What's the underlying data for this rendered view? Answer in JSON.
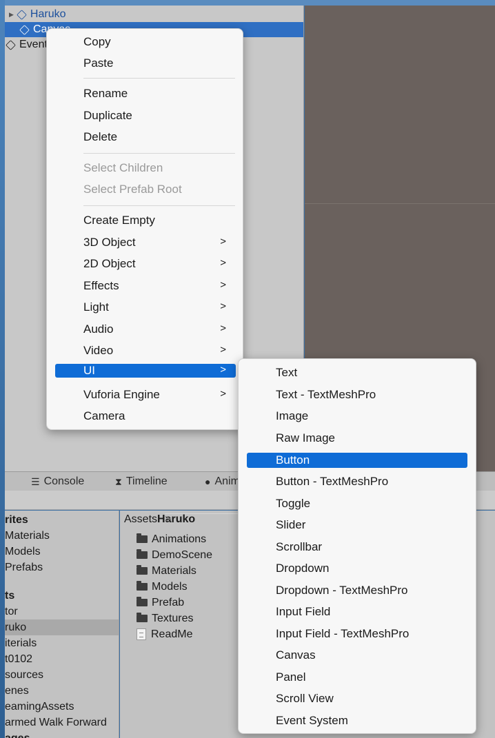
{
  "hierarchy": {
    "items": [
      "Haruko",
      "Canvas",
      "EventSystem"
    ]
  },
  "bottom_tabs": {
    "console": "Console",
    "timeline": "Timeline",
    "animation": "Animation"
  },
  "project": {
    "left_items": [
      {
        "label": "rites",
        "bold": true
      },
      {
        "label": "Materials"
      },
      {
        "label": "Models"
      },
      {
        "label": "Prefabs"
      },
      {
        "label": "ts",
        "bold": true
      },
      {
        "label": "tor"
      },
      {
        "label": "ruko"
      },
      {
        "label": "iterials"
      },
      {
        "label": "t0102"
      },
      {
        "label": "sources"
      },
      {
        "label": "enes"
      },
      {
        "label": "eamingAssets"
      },
      {
        "label": "armed Walk Forward"
      },
      {
        "label": "ages"
      }
    ],
    "breadcrumb": {
      "root": "Assets",
      "separator": ">",
      "current": "Haruko"
    },
    "assets": [
      {
        "label": "Animations",
        "icon": "folder-icon"
      },
      {
        "label": "DemoScene",
        "icon": "folder-icon"
      },
      {
        "label": "Materials",
        "icon": "folder-icon"
      },
      {
        "label": "Models",
        "icon": "folder-icon"
      },
      {
        "label": "Prefab",
        "icon": "folder-icon"
      },
      {
        "label": "Textures",
        "icon": "folder-icon"
      },
      {
        "label": "ReadMe",
        "icon": "document-icon"
      }
    ]
  },
  "context_menu": {
    "items": [
      {
        "label": "Copy"
      },
      {
        "label": "Paste"
      },
      {
        "label": "Rename"
      },
      {
        "label": "Duplicate"
      },
      {
        "label": "Delete"
      },
      {
        "label": "Select Children",
        "disabled": true
      },
      {
        "label": "Select Prefab Root",
        "disabled": true
      },
      {
        "label": "Create Empty"
      },
      {
        "label": "3D Object",
        "submenu": true
      },
      {
        "label": "2D Object",
        "submenu": true
      },
      {
        "label": "Effects",
        "submenu": true
      },
      {
        "label": "Light",
        "submenu": true
      },
      {
        "label": "Audio",
        "submenu": true
      },
      {
        "label": "Video",
        "submenu": true
      },
      {
        "label": "UI",
        "submenu": true,
        "selected": true
      },
      {
        "label": "Vuforia Engine",
        "submenu": true
      },
      {
        "label": "Camera"
      }
    ],
    "arrow": ">"
  },
  "ui_submenu": {
    "items": [
      {
        "label": "Text"
      },
      {
        "label": "Text - TextMeshPro"
      },
      {
        "label": "Image"
      },
      {
        "label": "Raw Image"
      },
      {
        "label": "Button",
        "selected": true
      },
      {
        "label": "Button - TextMeshPro"
      },
      {
        "label": "Toggle"
      },
      {
        "label": "Slider"
      },
      {
        "label": "Scrollbar"
      },
      {
        "label": "Dropdown"
      },
      {
        "label": "Dropdown - TextMeshPro"
      },
      {
        "label": "Input Field"
      },
      {
        "label": "Input Field - TextMeshPro"
      },
      {
        "label": "Canvas"
      },
      {
        "label": "Panel"
      },
      {
        "label": "Scroll View"
      },
      {
        "label": "Event System"
      }
    ]
  },
  "colors": {
    "selection": "#0f6cd6",
    "hierarchy_selection": "#2f6fc3",
    "scene_bg": "#6a615d"
  }
}
